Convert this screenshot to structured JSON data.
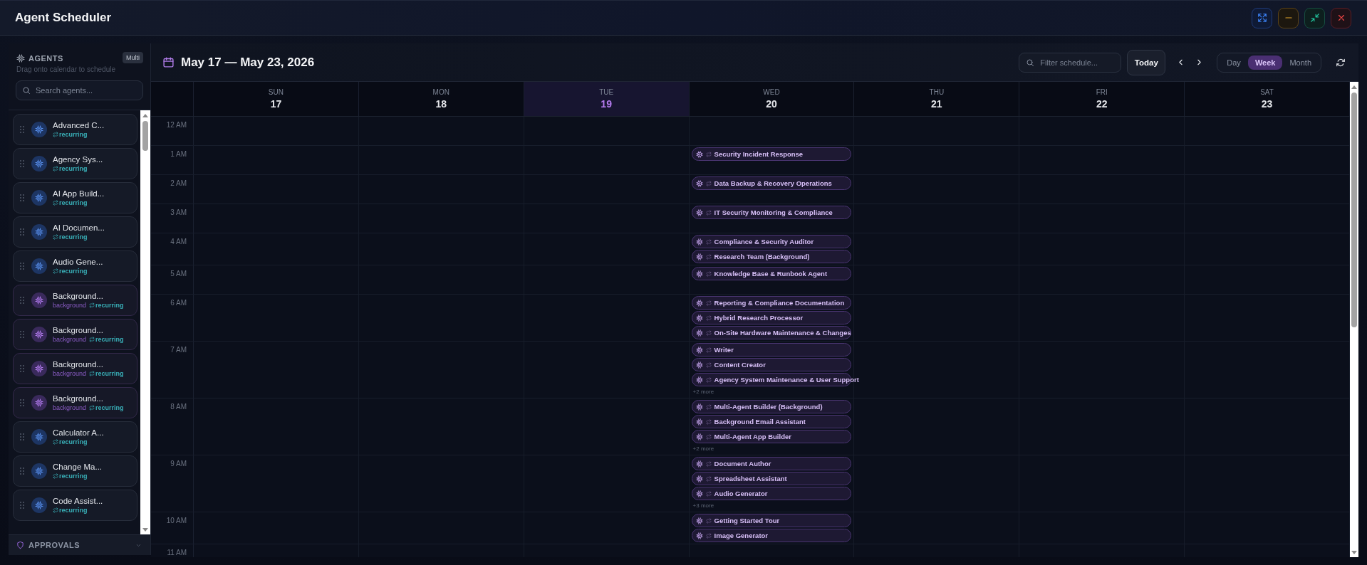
{
  "window": {
    "title": "Agent Scheduler"
  },
  "sidebar": {
    "title": "AGENTS",
    "mode_badge": "Multi",
    "hint": "Drag onto calendar to schedule",
    "search": {
      "placeholder": "Search agents..."
    },
    "agents": [
      {
        "name": "Advanced C...",
        "kind": "standard",
        "tags": [
          {
            "kind": "recurring",
            "label": "recurring"
          }
        ]
      },
      {
        "name": "Agency Sys...",
        "kind": "standard",
        "tags": [
          {
            "kind": "recurring",
            "label": "recurring"
          }
        ]
      },
      {
        "name": "AI App Build...",
        "kind": "standard",
        "tags": [
          {
            "kind": "recurring",
            "label": "recurring"
          }
        ]
      },
      {
        "name": "AI Documen...",
        "kind": "standard",
        "tags": [
          {
            "kind": "recurring",
            "label": "recurring"
          }
        ]
      },
      {
        "name": "Audio Gene...",
        "kind": "standard",
        "tags": [
          {
            "kind": "recurring",
            "label": "recurring"
          }
        ]
      },
      {
        "name": "Background...",
        "kind": "background",
        "tags": [
          {
            "kind": "background",
            "label": "background"
          },
          {
            "kind": "recurring",
            "label": "recurring"
          }
        ]
      },
      {
        "name": "Background...",
        "kind": "background",
        "tags": [
          {
            "kind": "background",
            "label": "background"
          },
          {
            "kind": "recurring",
            "label": "recurring"
          }
        ]
      },
      {
        "name": "Background...",
        "kind": "background",
        "tags": [
          {
            "kind": "background",
            "label": "background"
          },
          {
            "kind": "recurring",
            "label": "recurring"
          }
        ]
      },
      {
        "name": "Background...",
        "kind": "background",
        "tags": [
          {
            "kind": "background",
            "label": "background"
          },
          {
            "kind": "recurring",
            "label": "recurring"
          }
        ]
      },
      {
        "name": "Calculator A...",
        "kind": "standard",
        "tags": [
          {
            "kind": "recurring",
            "label": "recurring"
          }
        ]
      },
      {
        "name": "Change Ma...",
        "kind": "standard",
        "tags": [
          {
            "kind": "recurring",
            "label": "recurring"
          }
        ]
      },
      {
        "name": "Code Assist...",
        "kind": "standard",
        "tags": [
          {
            "kind": "recurring",
            "label": "recurring"
          }
        ]
      }
    ],
    "approvals": {
      "title": "APPROVALS",
      "expanded": false
    }
  },
  "calendar": {
    "range_title": "May 17 — May 23, 2026",
    "filter": {
      "placeholder": "Filter schedule..."
    },
    "today_button": "Today",
    "views": [
      {
        "label": "Day",
        "selected": false
      },
      {
        "label": "Week",
        "selected": true
      },
      {
        "label": "Month",
        "selected": false
      }
    ],
    "days": [
      {
        "weekday": "SUN",
        "date": "17",
        "today": false
      },
      {
        "weekday": "MON",
        "date": "18",
        "today": false
      },
      {
        "weekday": "TUE",
        "date": "19",
        "today": true
      },
      {
        "weekday": "WED",
        "date": "20",
        "today": false
      },
      {
        "weekday": "THU",
        "date": "21",
        "today": false
      },
      {
        "weekday": "FRI",
        "date": "22",
        "today": false
      },
      {
        "weekday": "SAT",
        "date": "23",
        "today": false
      }
    ],
    "hours": [
      {
        "label": "12 AM",
        "cells": [
          {},
          {},
          {},
          {},
          {},
          {},
          {}
        ]
      },
      {
        "label": "1 AM",
        "cells": [
          {},
          {},
          {},
          {
            "events": [
              {
                "title": "Security Incident Response",
                "recurring": true
              }
            ]
          },
          {},
          {},
          {}
        ]
      },
      {
        "label": "2 AM",
        "cells": [
          {},
          {},
          {},
          {
            "events": [
              {
                "title": "Data Backup & Recovery Operations",
                "recurring": true
              }
            ]
          },
          {},
          {},
          {}
        ]
      },
      {
        "label": "3 AM",
        "cells": [
          {},
          {},
          {},
          {
            "events": [
              {
                "title": "IT Security Monitoring & Compliance",
                "recurring": true
              }
            ]
          },
          {},
          {},
          {}
        ]
      },
      {
        "label": "4 AM",
        "cells": [
          {},
          {},
          {},
          {
            "events": [
              {
                "title": "Compliance & Security Auditor",
                "recurring": true
              },
              {
                "title": "Research Team (Background)",
                "recurring": true
              }
            ]
          },
          {},
          {},
          {}
        ]
      },
      {
        "label": "5 AM",
        "cells": [
          {},
          {},
          {},
          {
            "events": [
              {
                "title": "Knowledge Base & Runbook Agent",
                "recurring": true
              }
            ]
          },
          {},
          {},
          {}
        ]
      },
      {
        "label": "6 AM",
        "cells": [
          {},
          {},
          {},
          {
            "events": [
              {
                "title": "Reporting & Compliance Documentation",
                "recurring": true
              },
              {
                "title": "Hybrid Research Processor",
                "recurring": true
              },
              {
                "title": "On-Site Hardware Maintenance & Changes",
                "recurring": true
              }
            ]
          },
          {},
          {},
          {}
        ]
      },
      {
        "label": "7 AM",
        "cells": [
          {},
          {},
          {},
          {
            "events": [
              {
                "title": "Writer",
                "recurring": true
              },
              {
                "title": "Content Creator",
                "recurring": true
              },
              {
                "title": "Agency System Maintenance & User Support",
                "recurring": true
              }
            ],
            "more": "+2 more"
          },
          {},
          {},
          {}
        ]
      },
      {
        "label": "8 AM",
        "cells": [
          {},
          {},
          {},
          {
            "events": [
              {
                "title": "Multi-Agent Builder (Background)",
                "recurring": true
              },
              {
                "title": "Background Email Assistant",
                "recurring": true
              },
              {
                "title": "Multi-Agent App Builder",
                "recurring": true
              }
            ],
            "more": "+2 more"
          },
          {},
          {},
          {}
        ]
      },
      {
        "label": "9 AM",
        "cells": [
          {},
          {},
          {},
          {
            "events": [
              {
                "title": "Document Author",
                "recurring": true
              },
              {
                "title": "Spreadsheet Assistant",
                "recurring": true
              },
              {
                "title": "Audio Generator",
                "recurring": true
              }
            ],
            "more": "+3 more"
          },
          {},
          {},
          {}
        ]
      },
      {
        "label": "10 AM",
        "cells": [
          {},
          {},
          {},
          {
            "events": [
              {
                "title": "Getting Started Tour",
                "recurring": true
              },
              {
                "title": "Image Generator",
                "recurring": true
              }
            ]
          },
          {},
          {},
          {}
        ]
      },
      {
        "label": "11 AM",
        "cells": [
          {},
          {},
          {},
          {},
          {},
          {},
          {}
        ]
      }
    ]
  }
}
